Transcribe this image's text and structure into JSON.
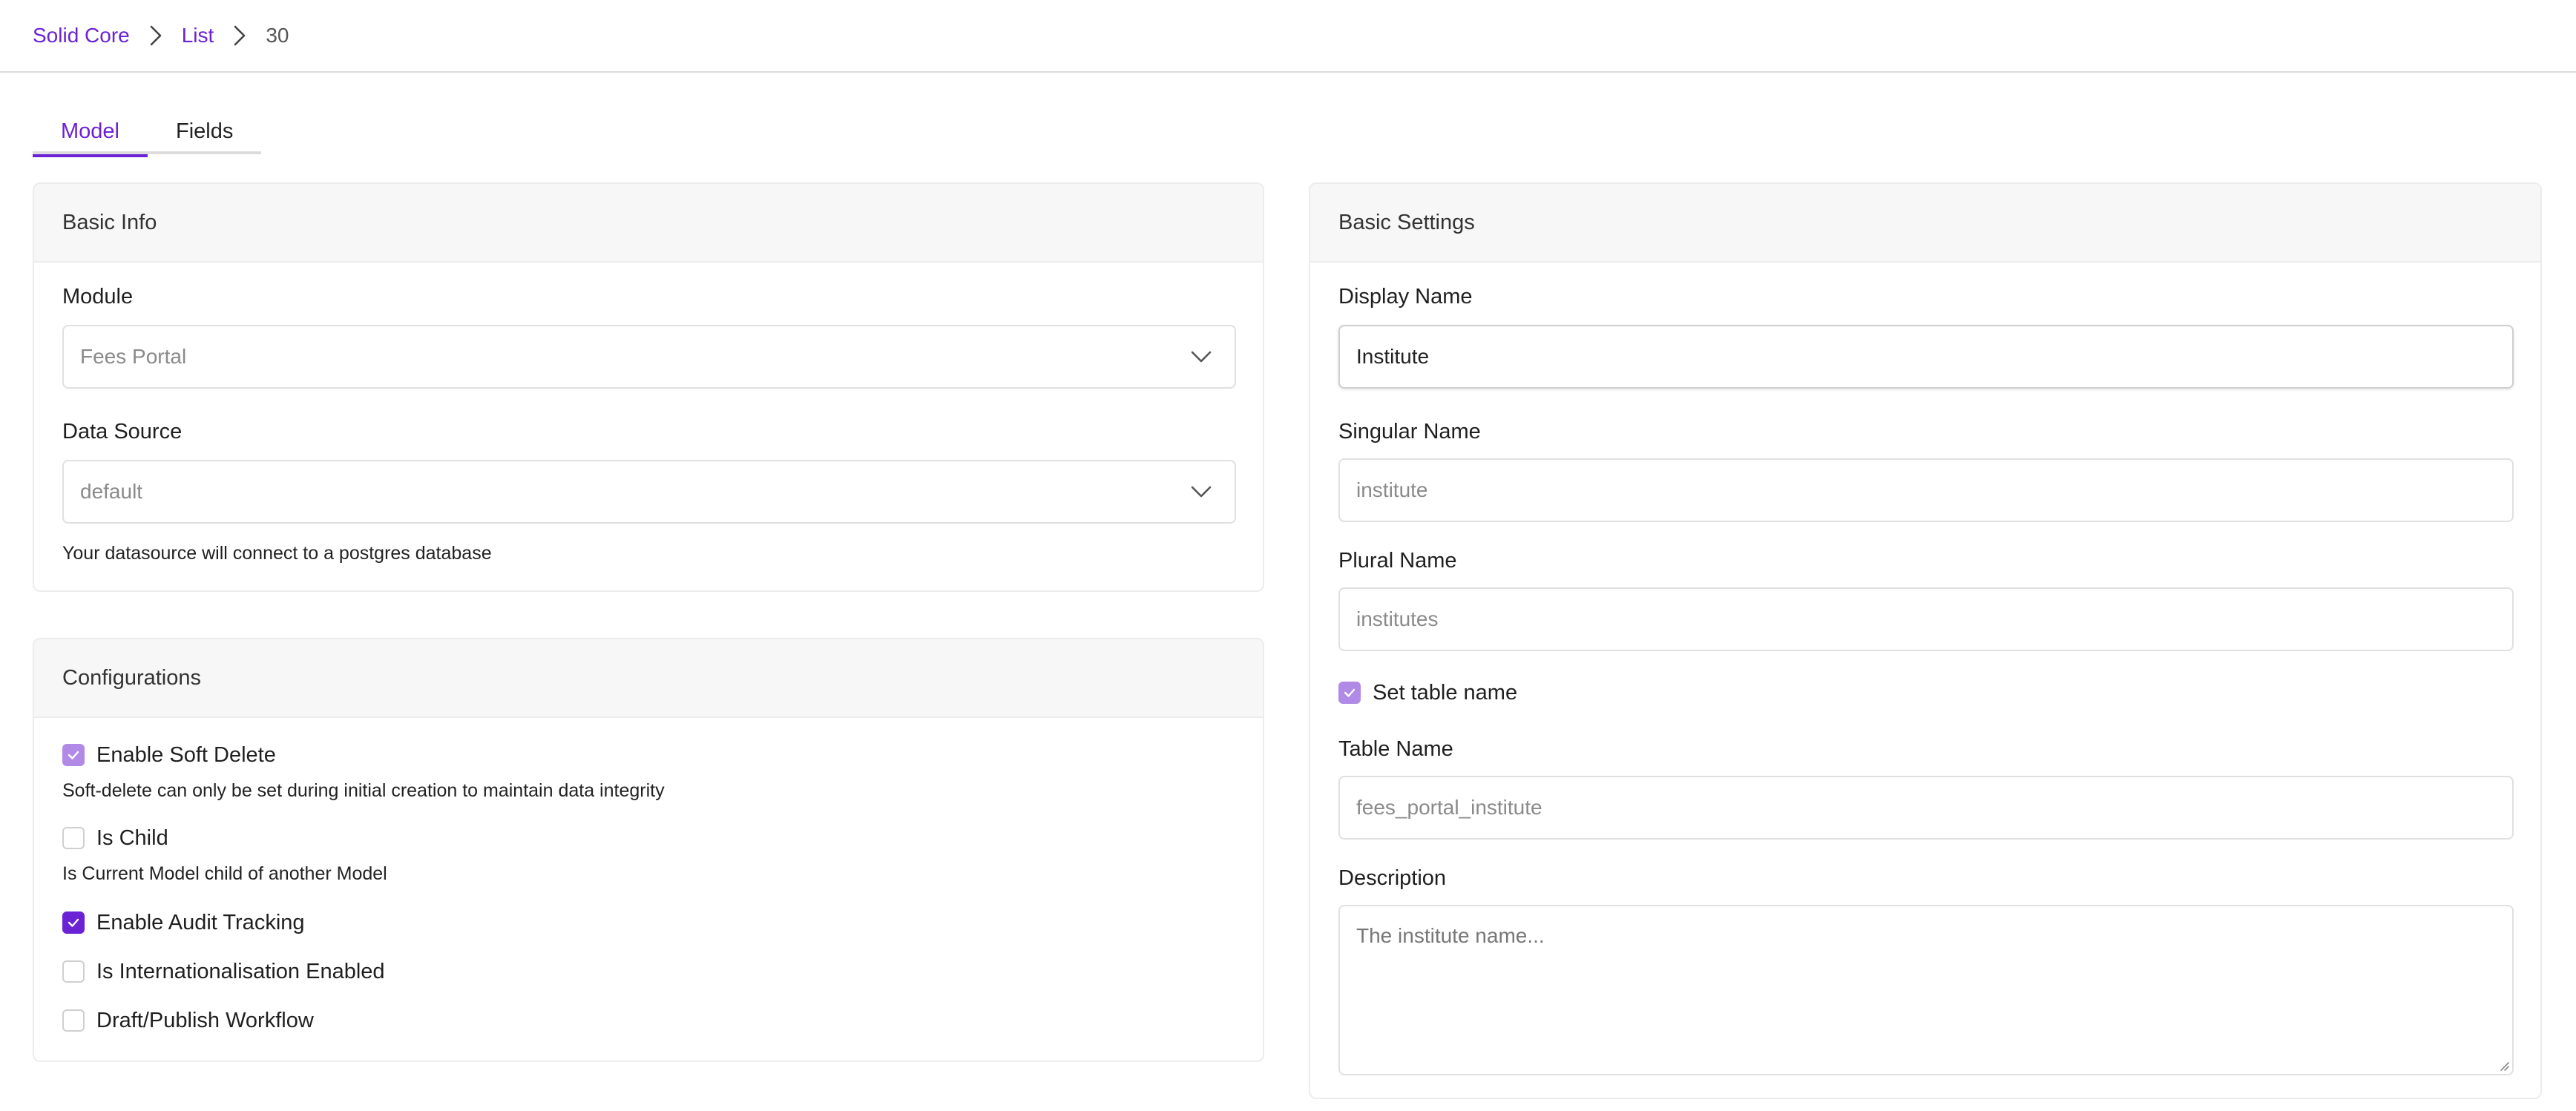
{
  "breadcrumb": {
    "items": [
      {
        "label": "Solid Core"
      },
      {
        "label": "List"
      },
      {
        "label": "30"
      }
    ]
  },
  "tabs": [
    {
      "label": "Model",
      "active": true
    },
    {
      "label": "Fields",
      "active": false
    }
  ],
  "basic_info": {
    "title": "Basic Info",
    "module": {
      "label": "Module",
      "value": "Fees Portal"
    },
    "data_source": {
      "label": "Data Source",
      "value": "default",
      "help": "Your datasource will connect to a postgres database"
    }
  },
  "configurations": {
    "title": "Configurations",
    "options": [
      {
        "label": "Enable Soft Delete",
        "checked": true,
        "disabled": true,
        "help": "Soft-delete can only be set during initial creation to maintain data integrity"
      },
      {
        "label": "Is Child",
        "checked": false,
        "help": "Is Current Model child of another Model"
      },
      {
        "label": "Enable Audit Tracking",
        "checked": true
      },
      {
        "label": "Is Internationalisation Enabled",
        "checked": false
      },
      {
        "label": "Draft/Publish Workflow",
        "checked": false
      }
    ]
  },
  "basic_settings": {
    "title": "Basic Settings",
    "display_name": {
      "label": "Display Name",
      "value": "Institute"
    },
    "singular_name": {
      "label": "Singular Name",
      "placeholder": "institute"
    },
    "plural_name": {
      "label": "Plural Name",
      "placeholder": "institutes"
    },
    "set_table_name": {
      "label": "Set table name",
      "checked": true
    },
    "table_name": {
      "label": "Table Name",
      "placeholder": "fees_portal_institute"
    },
    "description": {
      "label": "Description",
      "placeholder": "The institute name..."
    }
  },
  "colors": {
    "accent": "#6a22d4",
    "accent_muted": "#b08ae6",
    "border": "#e0e0e0",
    "panel_header_bg": "#f7f7f7"
  },
  "icons": {
    "breadcrumb_separator": "chevron-right-icon",
    "select_arrow": "chevron-down-icon",
    "checkbox_mark": "check-icon"
  }
}
